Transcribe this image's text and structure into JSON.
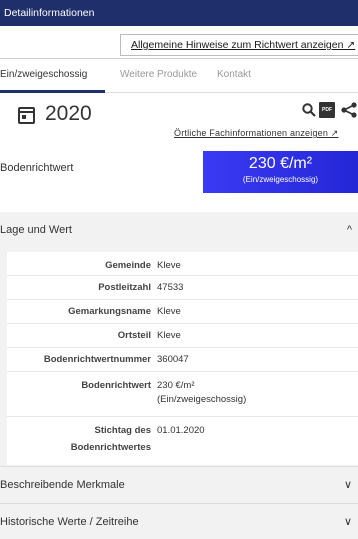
{
  "window": {
    "title": "Detailinformationen"
  },
  "hint_button": "Allgemeine Hinweise zum Richtwert anzeigen ↗",
  "tabs": [
    {
      "label": "Ein/zweigeschossig"
    },
    {
      "label": "Weitere Produkte"
    },
    {
      "label": "Kontakt"
    }
  ],
  "header": {
    "year": "2020",
    "fach_link": "Örtliche Fachinformationen anzeigen ↗",
    "pdf_text": "PDF"
  },
  "brw": {
    "label": "Bodenrichtwert",
    "value": "230 €/m²",
    "sub": "(Ein/zweigeschossig)"
  },
  "sections": {
    "lage": {
      "title": "Lage und Wert",
      "chevron": "^"
    },
    "merkmale": {
      "title": "Beschreibende Merkmale",
      "chevron": "∨"
    },
    "historisch": {
      "title": "Historische Werte / Zeitreihe",
      "chevron": "∨"
    }
  },
  "table": [
    {
      "key": "Gemeinde",
      "value": "Kleve"
    },
    {
      "key": "Postleitzahl",
      "value": "47533"
    },
    {
      "key": "Gemarkungsname",
      "value": "Kleve"
    },
    {
      "key": "Ortsteil",
      "value": "Kleve"
    },
    {
      "key": "Bodenrichtwertnummer",
      "value": "360047"
    },
    {
      "key": "Bodenrichtwert",
      "value": "230 €/m²",
      "value2": "(Ein/zweigeschossig)"
    },
    {
      "key": "Stichtag des",
      "key2": "Bodenrichtwertes",
      "value": "01.01.2020"
    }
  ],
  "colors": {
    "titlebar": "#1f2f6b",
    "accent": "#2a2ee0"
  }
}
